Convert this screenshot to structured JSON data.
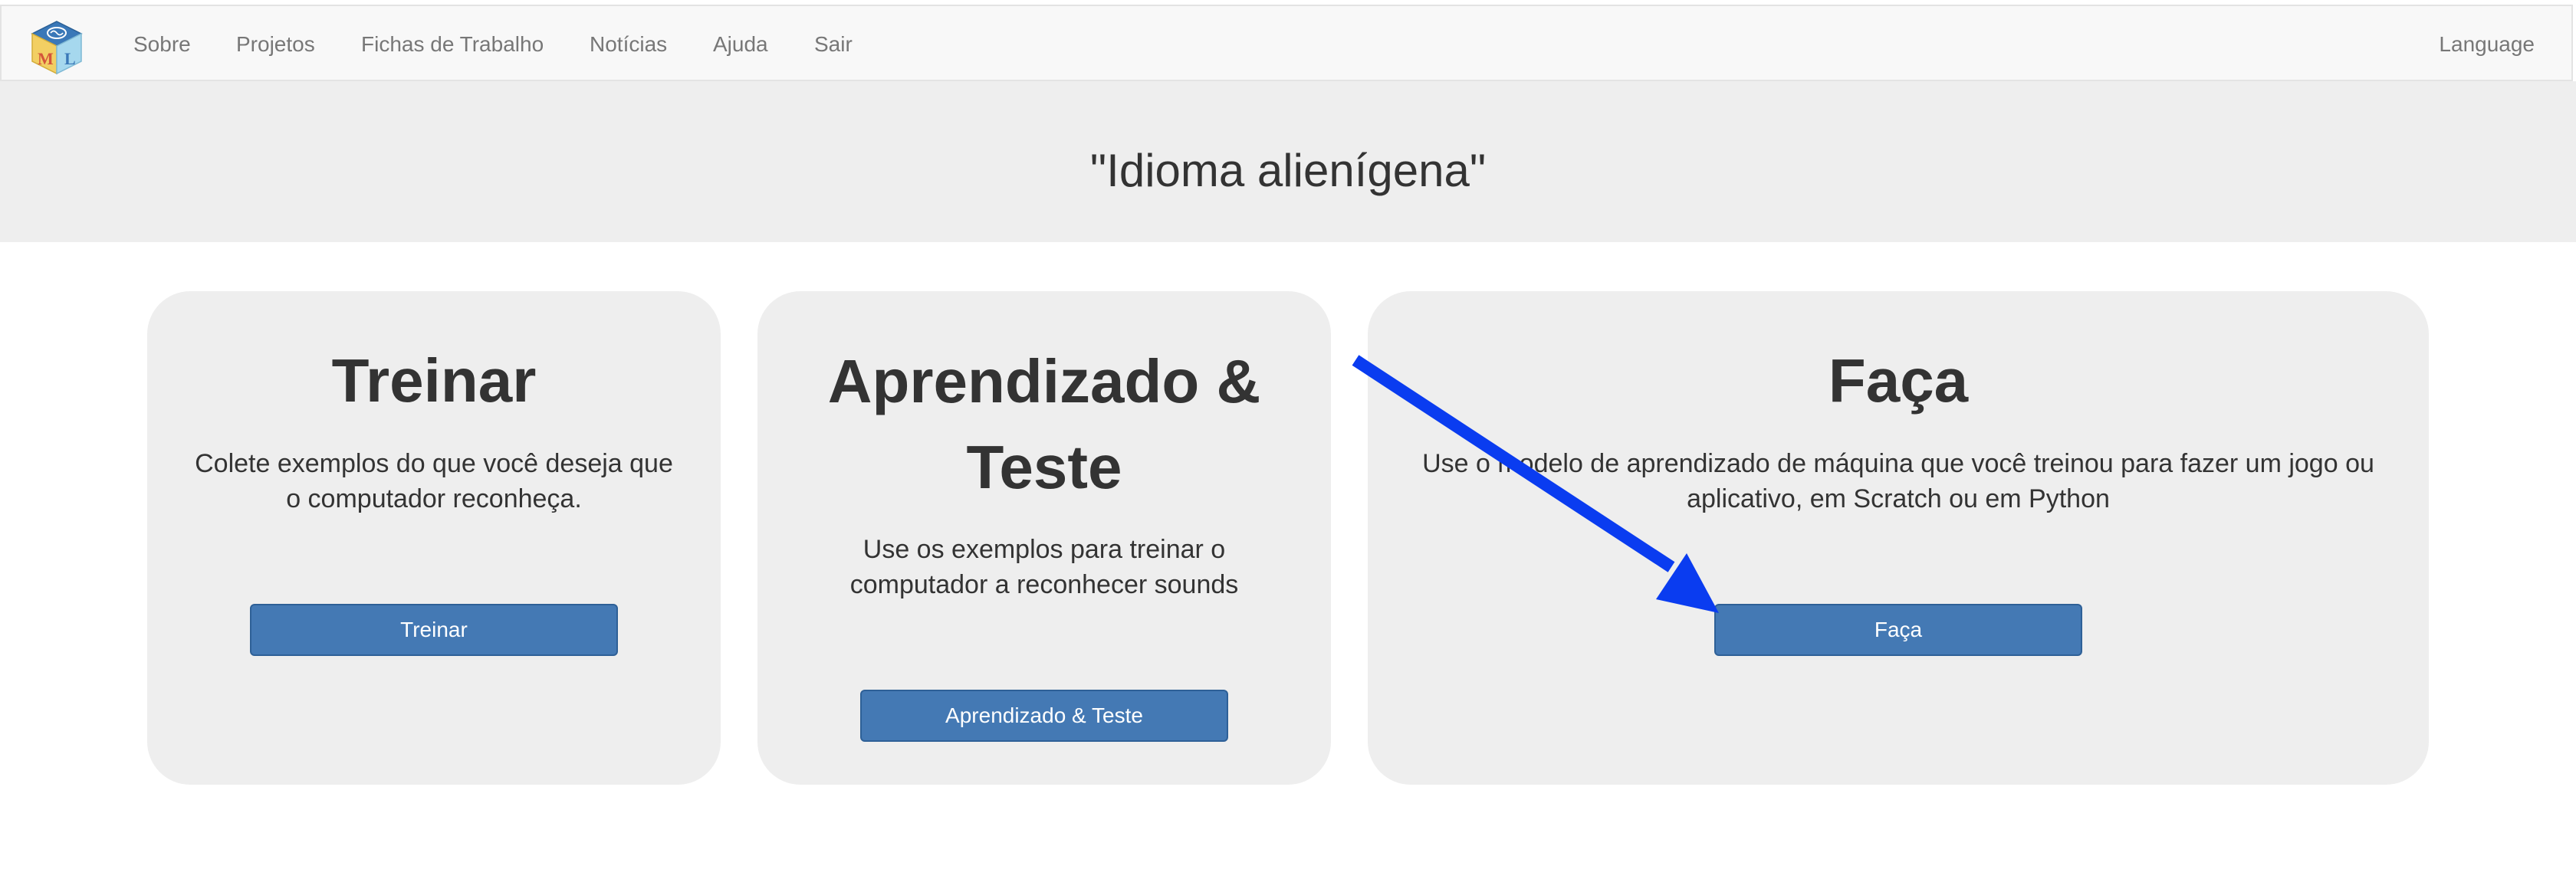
{
  "navbar": {
    "logo_letters": [
      "M",
      "L"
    ],
    "links": [
      {
        "label": "Sobre"
      },
      {
        "label": "Projetos"
      },
      {
        "label": "Fichas de Trabalho"
      },
      {
        "label": "Notícias"
      },
      {
        "label": "Ajuda"
      },
      {
        "label": "Sair"
      }
    ],
    "language_label": "Language"
  },
  "project": {
    "title": "\"Idioma alienígena\""
  },
  "cards": {
    "train": {
      "title": "Treinar",
      "description": "Colete exemplos do que você deseja que o computador reconheça.",
      "button_label": "Treinar"
    },
    "learn": {
      "title": "Aprendizado & Teste",
      "description": "Use os exemplos para treinar o computador a reconhecer sounds",
      "button_label": "Aprendizado & Teste"
    },
    "make": {
      "title": "Faça",
      "description": "Use o modelo de aprendizado de máquina que você treinou para fazer um jogo ou aplicativo, em Scratch ou em Python",
      "button_label": "Faça"
    }
  },
  "colors": {
    "button_bg": "#4479b4",
    "jumbotron_bg": "#eeeeee",
    "card_bg": "#eeeeee",
    "navbar_bg": "#f8f8f8",
    "arrow": "#0a3cf0"
  },
  "icons": {
    "logo": "ml-cube-logo-icon",
    "annotation": "pointer-arrow-icon"
  }
}
